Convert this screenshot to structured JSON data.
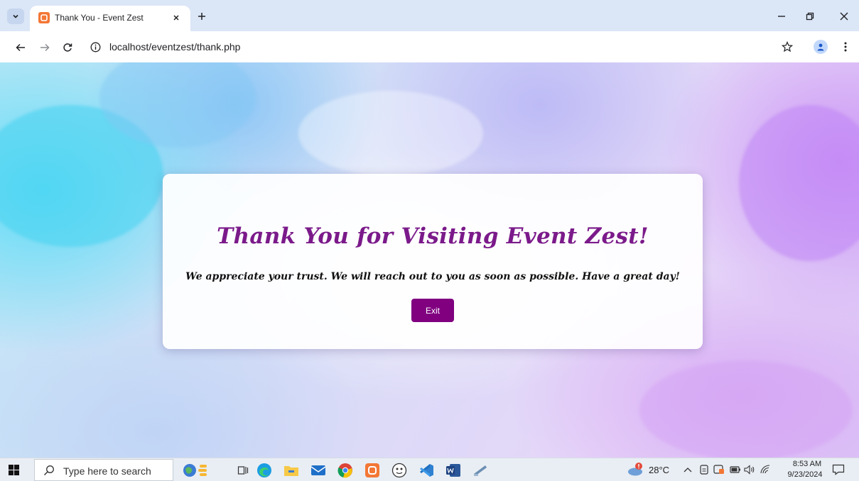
{
  "browser": {
    "tab": {
      "title": "Thank You - Event Zest",
      "favicon": "xampp-icon"
    },
    "url": "localhost/eventzest/thank.php"
  },
  "page": {
    "title": "Thank You for Visiting Event Zest!",
    "message": "We appreciate your trust. We will reach out to you as soon as possible. Have a great day!",
    "exit_label": "Exit",
    "colors": {
      "title": "#7b1a8a",
      "button": "#800080"
    }
  },
  "taskbar": {
    "search_placeholder": "Type here to search",
    "temperature": "28°C",
    "time": "8:53 AM",
    "date": "9/23/2024",
    "pinned_apps": [
      "widgets-icon",
      "task-view-icon",
      "edge-icon",
      "file-explorer-icon",
      "mail-icon",
      "chrome-icon",
      "xampp-icon",
      "app-icon",
      "vscode-icon",
      "word-icon",
      "app-icon-2"
    ]
  }
}
